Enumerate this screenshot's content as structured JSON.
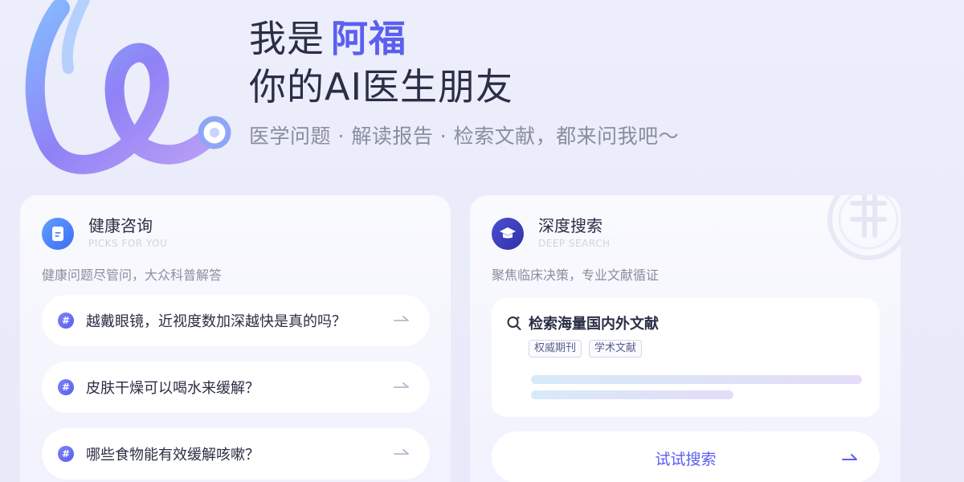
{
  "hero": {
    "greeting": "我是",
    "name": "阿福",
    "tagline": "你的AI医生朋友",
    "subtitle": "医学问题 · 解读报告 · 检索文献，都来问我吧～"
  },
  "cards": {
    "health": {
      "title": "健康咨询",
      "subtitle_en": "PICKS FOR YOU",
      "description": "健康问题尽管问，大众科普解答",
      "icon": "document-icon",
      "questions": [
        "越戴眼镜，近视度数加深越快是真的吗？",
        "皮肤干燥可以喝水来缓解？",
        "哪些食物能有效缓解咳嗽？"
      ]
    },
    "search": {
      "title": "深度搜索",
      "subtitle_en": "DEEP SEARCH",
      "description": "聚焦临床决策，专业文献循证",
      "icon": "graduation-cap-icon",
      "box_title": "检索海量国内外文献",
      "tags": [
        "权威期刊",
        "学术文献"
      ],
      "button_label": "试试搜索"
    }
  },
  "colors": {
    "accent": "#5b5ff0",
    "background": "#eceefb",
    "text": "#2b2e45",
    "muted": "#8a8d9f"
  }
}
